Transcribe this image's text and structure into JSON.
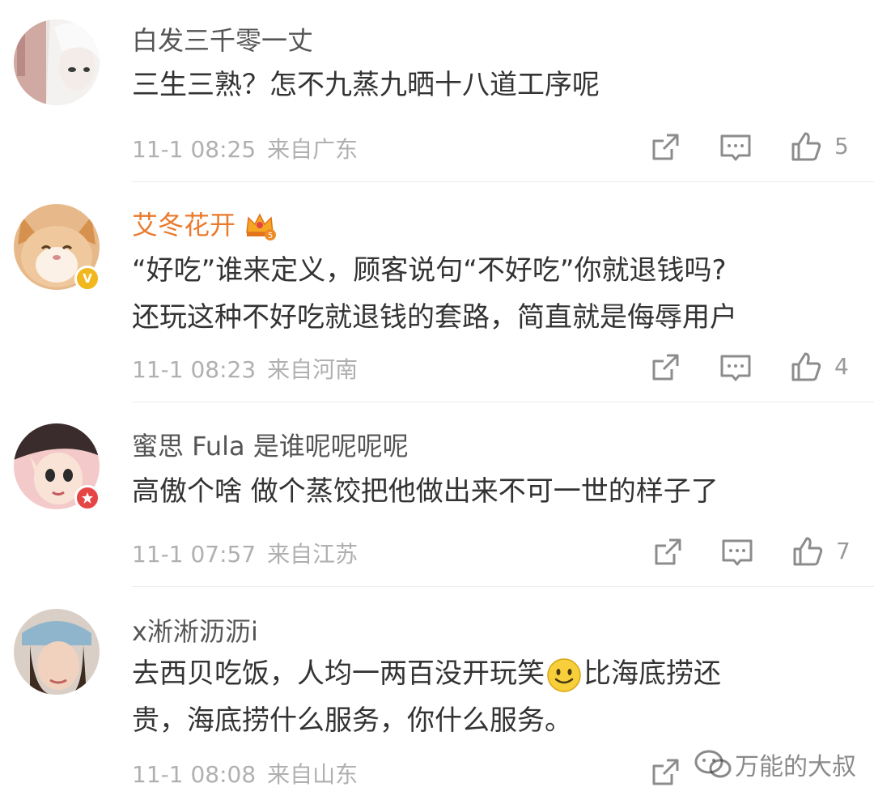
{
  "comments": [
    {
      "username": "白发三千零一丈",
      "lines": [
        "三生三熟？怎不九蒸九晒十八道工序呢"
      ],
      "time": "11-1 08:25",
      "location": "来自广东",
      "likes": "5"
    },
    {
      "username": "艾冬花开",
      "badge_level": "5",
      "verified_label": "V",
      "lines": [
        "“好吃”谁来定义，顾客说句“不好吃”你就退钱吗?",
        "还玩这种不好吃就退钱的套路，简直就是侮辱用户"
      ],
      "time": "11-1 08:23",
      "location": "来自河南",
      "likes": "4"
    },
    {
      "username": "蜜思 Fula 是谁呢呢呢呢",
      "lines": [
        "高傲个啥 做个蒸饺把他做出来不可一世的样子了"
      ],
      "time": "11-1 07:57",
      "location": "来自江苏",
      "likes": "7"
    },
    {
      "username": "x淅淅沥沥i",
      "lines_part1": "去西贝吃饭，人均一两百没开玩笑",
      "lines_part2": "比海底捞还",
      "line2": "贵，海底捞什么服务，你什么服务。",
      "time": "11-1 08:08",
      "location": "来自山东"
    }
  ],
  "watermark": "万能的大叔",
  "colors": {
    "vip_name": "#ea7a2c",
    "meta": "#b0b0b0",
    "text": "#333333",
    "icon": "#8c8c8c"
  }
}
